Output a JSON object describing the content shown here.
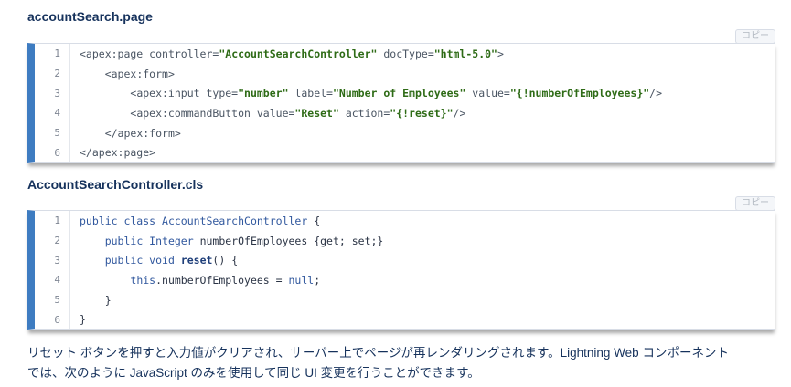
{
  "sections": [
    {
      "title": "accountSearch.page",
      "copy_label": "コピー",
      "lines": [
        {
          "num": "1",
          "tokens": [
            [
              "tag",
              "<apex:page "
            ],
            [
              "attr",
              "controller="
            ],
            [
              "str",
              "\"AccountSearchController\""
            ],
            [
              "attr",
              " docType="
            ],
            [
              "str",
              "\"html-5.0\""
            ],
            [
              "tag",
              ">"
            ]
          ]
        },
        {
          "num": "2",
          "tokens": [
            [
              "plain",
              "    "
            ],
            [
              "tag",
              "<apex:form>"
            ]
          ]
        },
        {
          "num": "3",
          "tokens": [
            [
              "plain",
              "        "
            ],
            [
              "tag",
              "<apex:input "
            ],
            [
              "attr",
              "type="
            ],
            [
              "str",
              "\"number\""
            ],
            [
              "attr",
              " label="
            ],
            [
              "str",
              "\"Number of Employees\""
            ],
            [
              "attr",
              " value="
            ],
            [
              "str",
              "\"{!numberOfEmployees}\""
            ],
            [
              "tag",
              "/>"
            ]
          ]
        },
        {
          "num": "4",
          "tokens": [
            [
              "plain",
              "        "
            ],
            [
              "tag",
              "<apex:commandButton "
            ],
            [
              "attr",
              "value="
            ],
            [
              "str",
              "\"Reset\""
            ],
            [
              "attr",
              " action="
            ],
            [
              "str",
              "\"{!reset}\""
            ],
            [
              "tag",
              "/>"
            ]
          ]
        },
        {
          "num": "5",
          "tokens": [
            [
              "plain",
              "    "
            ],
            [
              "tag",
              "</apex:form>"
            ]
          ]
        },
        {
          "num": "6",
          "tokens": [
            [
              "tag",
              "</apex:page>"
            ]
          ]
        }
      ]
    },
    {
      "title": "AccountSearchController.cls",
      "copy_label": "コピー",
      "lines": [
        {
          "num": "1",
          "tokens": [
            [
              "kw",
              "public class "
            ],
            [
              "type",
              "AccountSearchController"
            ],
            [
              "plain",
              " {"
            ]
          ]
        },
        {
          "num": "2",
          "tokens": [
            [
              "plain",
              "    "
            ],
            [
              "kw",
              "public "
            ],
            [
              "type",
              "Integer"
            ],
            [
              "plain",
              " numberOfEmployees {get; set;}"
            ]
          ]
        },
        {
          "num": "3",
          "tokens": [
            [
              "plain",
              "    "
            ],
            [
              "kw",
              "public void "
            ],
            [
              "fn",
              "reset"
            ],
            [
              "plain",
              "() {"
            ]
          ]
        },
        {
          "num": "4",
          "tokens": [
            [
              "plain",
              "        "
            ],
            [
              "kw",
              "this"
            ],
            [
              "plain",
              ".numberOfEmployees = "
            ],
            [
              "lit",
              "null"
            ],
            [
              "plain",
              ";"
            ]
          ]
        },
        {
          "num": "5",
          "tokens": [
            [
              "plain",
              "    }"
            ]
          ]
        },
        {
          "num": "6",
          "tokens": [
            [
              "plain",
              "}"
            ]
          ]
        }
      ]
    }
  ],
  "paragraph": {
    "line1": "リセット ボタンを押すと入力値がクリアされ、サーバー上でページが再レンダリングされます。Lightning Web コンポーネント",
    "line2": "では、次のように JavaScript のみを使用して同じ UI 変更を行うことができます。"
  }
}
